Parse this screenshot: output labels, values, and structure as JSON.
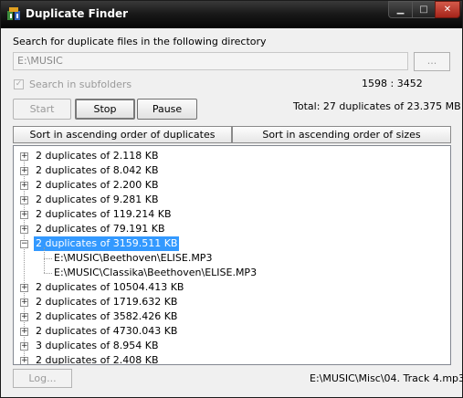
{
  "window": {
    "title": "Duplicate Finder",
    "min_glyph": "▁",
    "max_glyph": "□",
    "close_glyph": "✕"
  },
  "search": {
    "label": "Search for duplicate files in the following directory",
    "directory": "E:\\MUSIC",
    "browse_label": "...",
    "subfolders_label": "Search in subfolders",
    "subfolders_checked": true,
    "progress": "1598 : 3452"
  },
  "buttons": {
    "start": "Start",
    "stop": "Stop",
    "pause": "Pause"
  },
  "summary": {
    "total": "Total: 27 duplicates of 23.375 MB"
  },
  "sort": {
    "by_duplicates": "Sort in ascending order of duplicates",
    "by_sizes": "Sort in ascending order of sizes"
  },
  "tree": {
    "items": [
      {
        "label": "2 duplicates of 2.118 KB",
        "expander": "+"
      },
      {
        "label": "2 duplicates of 8.042 KB",
        "expander": "+"
      },
      {
        "label": "2 duplicates of 2.200 KB",
        "expander": "+"
      },
      {
        "label": "2 duplicates of 9.281 KB",
        "expander": "+"
      },
      {
        "label": "2 duplicates of 119.214 KB",
        "expander": "+"
      },
      {
        "label": "2 duplicates of 79.191 KB",
        "expander": "+"
      },
      {
        "label": "2 duplicates of 3159.511 KB",
        "expander": "−",
        "selected": true,
        "children": [
          "E:\\MUSIC\\Beethoven\\ELISE.MP3",
          "E:\\MUSIC\\Classika\\Beethoven\\ELISE.MP3"
        ]
      },
      {
        "label": "2 duplicates of 10504.413 KB",
        "expander": "+"
      },
      {
        "label": "2 duplicates of 1719.632 KB",
        "expander": "+"
      },
      {
        "label": "2 duplicates of 3582.426 KB",
        "expander": "+"
      },
      {
        "label": "2 duplicates of 4730.043 KB",
        "expander": "+"
      },
      {
        "label": "3 duplicates of 8.954 KB",
        "expander": "+"
      },
      {
        "label": "2 duplicates of 2.408 KB",
        "expander": "+"
      }
    ]
  },
  "footer": {
    "log_label": "Log...",
    "current_file": "E:\\MUSIC\\Misc\\04. Track 4.mp3"
  },
  "colors": {
    "selection": "#3399ff",
    "window_bg": "#f0f0f0",
    "titlebar": "#1a1a1a"
  }
}
